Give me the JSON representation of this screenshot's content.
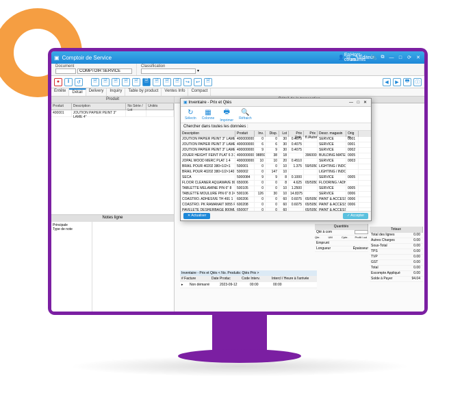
{
  "titlebar": {
    "title": "Comptoir de Service",
    "actions": [
      "En cours",
      "Hors-soumis",
      "Editeur"
    ]
  },
  "subbar": {
    "document_label": "Document",
    "classification_label": "Classification",
    "document_value": "COMPTOIR SERVICE"
  },
  "tabs": [
    "Entête",
    "Détail",
    "Delivery",
    "Inquiry",
    "Table by product",
    "Ventes Info",
    "Compact"
  ],
  "active_tab": 1,
  "product_section": {
    "title": "Produit",
    "columns": [
      "Produit",
      "Description",
      "No Série / Lot",
      "Unités"
    ],
    "rows": [
      {
        "produit": "400001",
        "description": "JOUTION PAPIER PEINT 3\" LAME 4\"",
        "serie": "",
        "unites": ""
      }
    ]
  },
  "detail_title": "Détail de la transaction",
  "modal": {
    "title": "Inventaire - Prix et Qtés",
    "tools": [
      "Sélectn",
      "Colonne",
      "Imprimer",
      "Réfraich"
    ],
    "search_label": "Chercher dans toutes les données :",
    "columns": [
      "Description",
      "Produit",
      "Inv.",
      "Disp.",
      "Lst",
      "Prix Unit.",
      "Prix pre",
      "Prix fl./Autre",
      "Descr. magasin",
      "Orig m"
    ],
    "rows": [
      {
        "desc": "JOUTION PAPIER PEINT 3\" LAME 4\"",
        "prod": "400000000001",
        "inv": "0",
        "disp": "0",
        "pl": "30",
        "pu": "0.4075",
        "pf": "",
        "mag": "SERVICE",
        "orig": "0001"
      },
      {
        "desc": "JOUTION PAPIER PEINT 3\" LAME 4\"",
        "prod": "400000000001",
        "inv": "6",
        "disp": "6",
        "pl": "30",
        "pu": "0.4075",
        "pf": "",
        "mag": "SERVICE",
        "orig": "0001"
      },
      {
        "desc": "JOUTION PAPIER PEINT 3\" LAME 4\"",
        "prod": "400000000002",
        "inv": "9",
        "disp": "9",
        "pl": "30",
        "pu": "0.4075",
        "pf": "",
        "mag": "SERVICE",
        "orig": "0002"
      },
      {
        "desc": "JOUER HEIGHT FEINT PLAT 6 3 3",
        "prod": "400000000003",
        "inv": "98859",
        "disp": "38",
        "pl": "18",
        "pu": "",
        "pf": "396000",
        "mag": "BUILDING MATERIAL",
        "orig": "0005"
      },
      {
        "desc": "JOPAL WOOD MERC PLAT 1 4",
        "prod": "400000000004",
        "inv": "10",
        "disp": "10",
        "pl": "20",
        "pu": "0.4510",
        "pf": "",
        "mag": "SERVICE",
        "orig": "0003"
      },
      {
        "desc": "BRAIL POUR 40202 380×1/2×1",
        "prod": "500001",
        "inv": "0",
        "disp": "0",
        "pl": "10",
        "pu": "1.375",
        "pf": "59/5050",
        "mag": "LIGHTING / INDOOR RST",
        "orig": ""
      },
      {
        "desc": "BRAIL POUR 40202 380×1/2×140",
        "prod": "500002",
        "inv": "0",
        "disp": "147",
        "pl": "10",
        "pu": "",
        "pf": "",
        "mag": "LIGHTING / INDOOR RST",
        "orig": ""
      },
      {
        "desc": "SECA",
        "prod": "5000084",
        "inv": "9",
        "disp": "9",
        "pl": "8",
        "pu": "0.1000",
        "pf": "",
        "mag": "SERVICE",
        "orig": "0005"
      },
      {
        "desc": "FLOOR CLEANER AQUAWAVE 800ML",
        "prod": "650006",
        "inv": "0",
        "disp": "0",
        "pl": "8",
        "pu": "4.625",
        "pf": "65/5050",
        "mag": "FLOORING / ADHES TILE",
        "orig": ""
      },
      {
        "desc": "TABLETTE MELAMINE PIN 6\" 8",
        "prod": "500105",
        "inv": "0",
        "disp": "0",
        "pl": "10",
        "pu": "1.2500",
        "pf": "",
        "mag": "SERVICE",
        "orig": "0005"
      },
      {
        "desc": "TABLETTE MOULURE PIN 6\" 8 24\"",
        "prod": "500106",
        "inv": "126",
        "disp": "30",
        "pl": "10",
        "pu": "14.8375",
        "pf": "",
        "mag": "SERVICE",
        "orig": "0006"
      },
      {
        "desc": "COASTRO. ADHESIVE TH 491 1",
        "prod": "600206",
        "inv": "0",
        "disp": "0",
        "pl": "60",
        "pu": "0.6075",
        "pf": "65/5050",
        "mag": "PAINT & ACCESS",
        "orig": "0006"
      },
      {
        "desc": "COASTRO. PK RAMANAIT 9055 R/L",
        "prod": "600208",
        "inv": "0",
        "disp": "0",
        "pl": "60",
        "pu": "0.6075",
        "pf": "65/5050",
        "mag": "PAINT & ACCESS",
        "orig": "0006"
      },
      {
        "desc": "PAVELETE DESHERBAGE 800ML",
        "prod": "650007",
        "inv": "0",
        "disp": "0",
        "pl": "60",
        "pu": "",
        "pf": "65/5050",
        "mag": "PAINT & ACCESS",
        "orig": ""
      }
    ],
    "btn_actualiser": "Actualiser",
    "btn_accepter": "Accepter"
  },
  "notes": {
    "title": "Notes ligne",
    "left_label": "Principale",
    "type_label": "Type de note"
  },
  "quantities": {
    "title": "Quantités",
    "qte_com_label": "Qté à com",
    "cols": [
      "Qte.",
      "UM",
      "Cpte.",
      "Profit / col"
    ],
    "emprunt": "Emprunt",
    "longueur": "Longueur",
    "epaisseur": "Épaisseur"
  },
  "totals": {
    "title": "Totaux",
    "rows": [
      {
        "label": "Total des lignes",
        "value": "0.00"
      },
      {
        "label": "Autres Charges",
        "value": "0.00"
      },
      {
        "label": "Sous-Total",
        "value": "0.00"
      },
      {
        "label": "TPS",
        "value": "0.00"
      },
      {
        "label": "TVP",
        "value": "0.00"
      },
      {
        "label": "GST",
        "value": "0.00"
      },
      {
        "label": "Total",
        "value": "0.00"
      },
      {
        "label": "Escompte Appliqué",
        "value": "0.00"
      },
      {
        "label": "Solde à Payer",
        "value": "94.04"
      }
    ]
  },
  "delivery": {
    "title": "Inventaire - Prix et Qtés < No. Produits: Qtés Prix >",
    "cols": [
      "# Facture",
      "Date Produc",
      "Code Interv.",
      "Intercl / Heure à l'arrivée"
    ],
    "row": {
      "facture": "Non démarré",
      "date": "2023-09-12",
      "code": "00:00",
      "interc": "00:00"
    }
  }
}
